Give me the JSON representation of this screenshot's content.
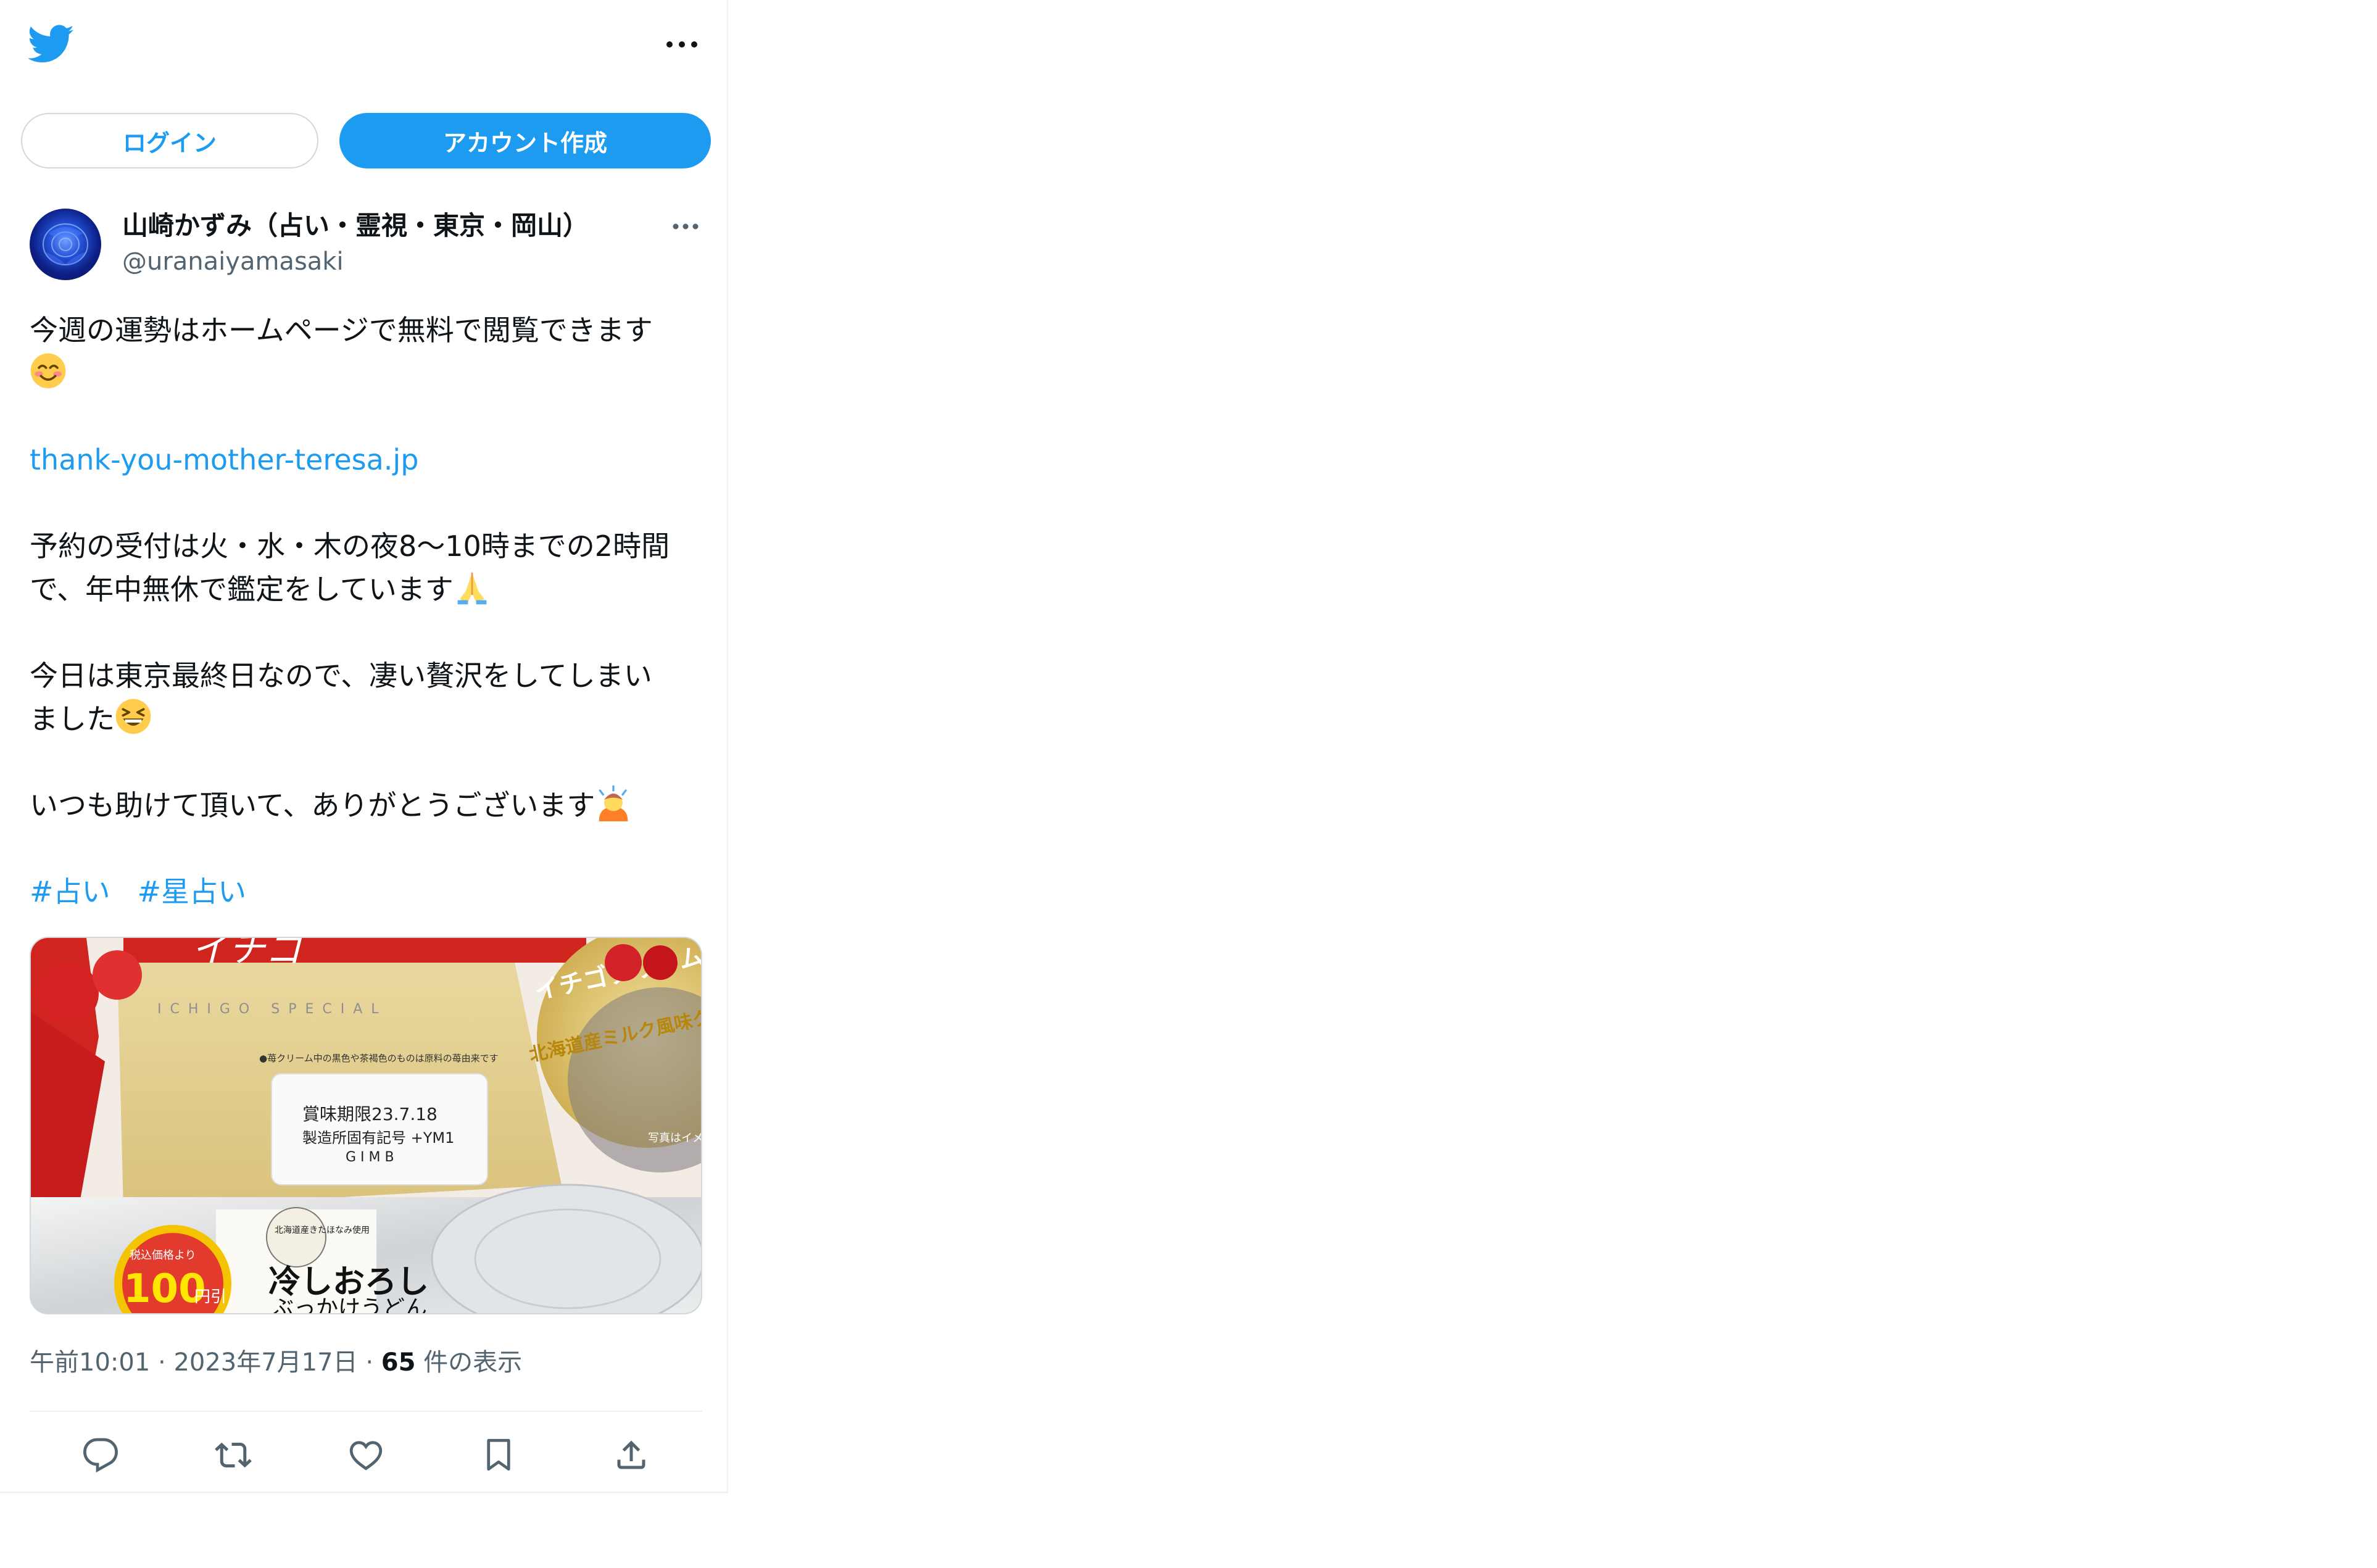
{
  "header": {
    "logo_icon": "twitter-bird-icon",
    "more_icon": "more-horizontal-icon"
  },
  "auth": {
    "login_label": "ログイン",
    "signup_label": "アカウント作成"
  },
  "tweet": {
    "author": {
      "display_name": "山崎かずみ（占い・霊視・東京・岡山）",
      "handle": "@uranaiyamasaki",
      "avatar_icon": "blue-rose-avatar"
    },
    "text": {
      "line1": "今週の運勢はホームページで無料で閲覧できます",
      "link": "thank-you-mother-teresa.jp",
      "para2_line1": "予約の受付は火・水・木の夜8～10時までの2時間",
      "para2_line2": "で、年中無休で鑑定をしています",
      "para3_line1": "今日は東京最終日なので、凄い贅沢をしてしまい",
      "para3_line2": "ました",
      "para4": "いつも助けて頂いて、ありがとうございます",
      "hashtags": [
        "#占い",
        "#星占い"
      ]
    },
    "photo": {
      "label_expiry": "賞味期限23.7.18",
      "label_code": "製造所固有記号 +YM1",
      "label_code2": "G I M B",
      "brand_text": "ICHIGO SPECIAL",
      "cream_label": "イチゴクリーム",
      "hokkaido_label": "北海道産ミルク風味クリーム",
      "note_label": "●苺クリーム中の黒色や茶褐色のものは原料の苺由来です",
      "udon_badge": "北海道産きたほなみ使用",
      "udon_title": "冷しおろし",
      "udon_sub": "ぶっかけうどん",
      "discount_small": "税込価格より",
      "discount_big": "100",
      "discount_unit": "円引",
      "photo_note": "写真はイメ"
    },
    "meta": {
      "time": "午前10:01",
      "date": "2023年7月17日",
      "views_count": "65",
      "views_label": "件の表示"
    },
    "actions": [
      "reply-icon",
      "retweet-icon",
      "like-icon",
      "bookmark-icon",
      "share-icon"
    ]
  },
  "colors": {
    "accent": "#1d9bf0",
    "text": "#0f1419",
    "muted": "#536471",
    "border": "#cfd9de"
  }
}
